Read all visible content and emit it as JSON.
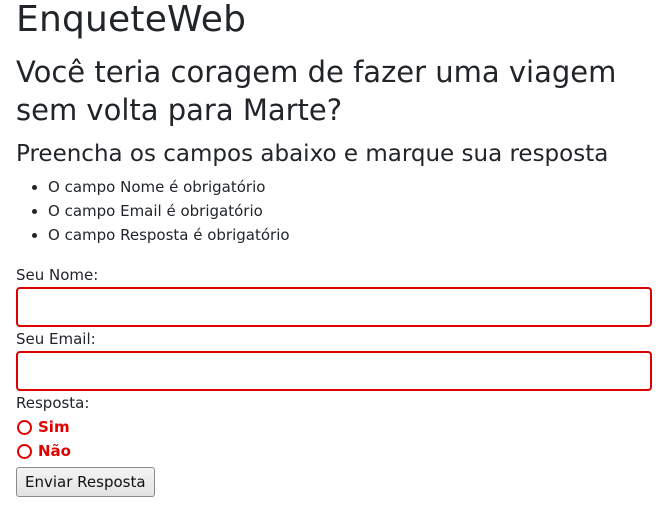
{
  "header": {
    "brand": "EnqueteWeb"
  },
  "poll": {
    "question": "Você teria coragem de fazer uma viagem sem volta para Marte?",
    "instructions": "Preencha os campos abaixo e marque sua resposta"
  },
  "validation": {
    "errors": [
      "O campo Nome é obrigatório",
      "O campo Email é obrigatório",
      "O campo Resposta é obrigatório"
    ]
  },
  "form": {
    "name_label": "Seu Nome:",
    "name_value": "",
    "email_label": "Seu Email:",
    "email_value": "",
    "answer_label": "Resposta:",
    "options": [
      "Sim",
      "Não"
    ],
    "submit_label": "Enviar Resposta"
  },
  "colors": {
    "error": "#dc0000",
    "text": "#212529"
  }
}
